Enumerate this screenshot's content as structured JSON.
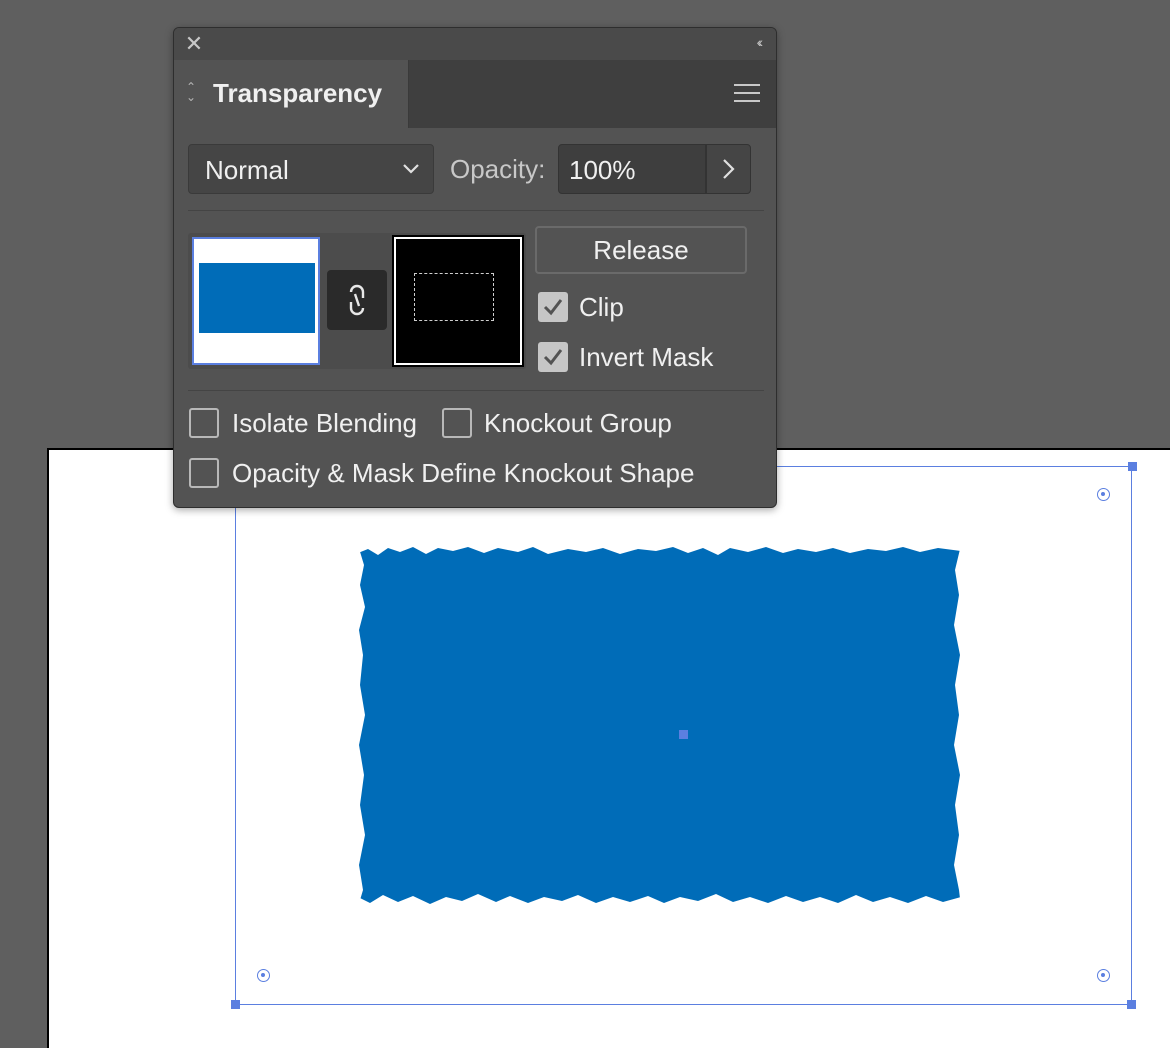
{
  "panel": {
    "title": "Transparency",
    "blend_mode": "Normal",
    "opacity_label": "Opacity:",
    "opacity_value": "100%",
    "release_label": "Release",
    "clip_label": "Clip",
    "clip_checked": true,
    "invert_mask_label": "Invert Mask",
    "invert_mask_checked": true,
    "isolate_blending_label": "Isolate Blending",
    "isolate_blending_checked": false,
    "knockout_group_label": "Knockout Group",
    "knockout_group_checked": false,
    "opacity_mask_knockout_label": "Opacity & Mask Define Knockout Shape",
    "opacity_mask_knockout_checked": false
  },
  "colors": {
    "object_fill": "#006cb8",
    "selection": "#5b7fe0",
    "panel_bg": "#535353",
    "canvas_bg": "#5f5f5f"
  },
  "icons": {
    "close": "close-icon",
    "collapse": "collapse-icon",
    "menu": "hamburger-menu-icon",
    "link": "link-icon",
    "dropdown": "chevron-down-icon",
    "opacity_arrow": "chevron-right-icon",
    "check": "checkmark-icon"
  }
}
